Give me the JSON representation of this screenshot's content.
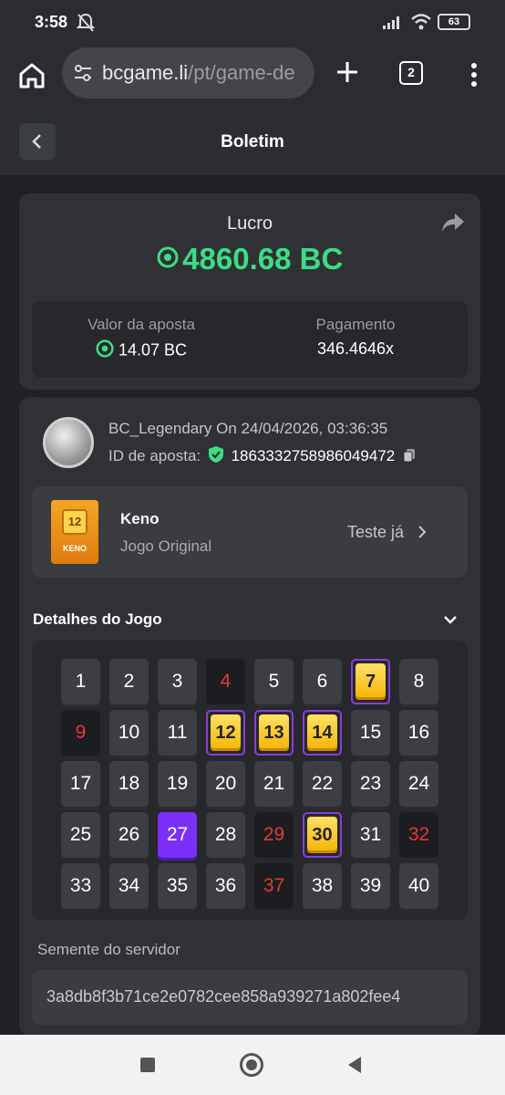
{
  "status": {
    "time": "3:58",
    "battery": "63"
  },
  "browser": {
    "url_host": "bcgame.li",
    "url_path": "/pt/game-de",
    "tab_count": "2"
  },
  "header": {
    "title": "Boletim"
  },
  "profit": {
    "label": "Lucro",
    "value": "4860.68 BC",
    "bet_label": "Valor da aposta",
    "bet_value": "14.07 BC",
    "payout_label": "Pagamento",
    "payout_value": "346.4646x"
  },
  "bet": {
    "user_line": "BC_Legendary On 24/04/2026, 03:36:35",
    "id_label": "ID de aposta:",
    "id_value": "1863332758986049472"
  },
  "game": {
    "name": "Keno",
    "subtitle": "Jogo Original",
    "try_label": "Teste já",
    "thumb_number": "12",
    "thumb_label": "KENO"
  },
  "details": {
    "title": "Detalhes do Jogo",
    "cells": [
      {
        "n": "1",
        "s": "normal"
      },
      {
        "n": "2",
        "s": "normal"
      },
      {
        "n": "3",
        "s": "normal"
      },
      {
        "n": "4",
        "s": "miss"
      },
      {
        "n": "5",
        "s": "normal"
      },
      {
        "n": "6",
        "s": "normal"
      },
      {
        "n": "7",
        "s": "hit"
      },
      {
        "n": "8",
        "s": "normal"
      },
      {
        "n": "9",
        "s": "miss"
      },
      {
        "n": "10",
        "s": "normal"
      },
      {
        "n": "11",
        "s": "normal"
      },
      {
        "n": "12",
        "s": "hit"
      },
      {
        "n": "13",
        "s": "hit"
      },
      {
        "n": "14",
        "s": "hit"
      },
      {
        "n": "15",
        "s": "normal"
      },
      {
        "n": "16",
        "s": "normal"
      },
      {
        "n": "17",
        "s": "normal"
      },
      {
        "n": "18",
        "s": "normal"
      },
      {
        "n": "19",
        "s": "normal"
      },
      {
        "n": "20",
        "s": "normal"
      },
      {
        "n": "21",
        "s": "normal"
      },
      {
        "n": "22",
        "s": "normal"
      },
      {
        "n": "23",
        "s": "normal"
      },
      {
        "n": "24",
        "s": "normal"
      },
      {
        "n": "25",
        "s": "normal"
      },
      {
        "n": "26",
        "s": "normal"
      },
      {
        "n": "27",
        "s": "pick"
      },
      {
        "n": "28",
        "s": "normal"
      },
      {
        "n": "29",
        "s": "miss"
      },
      {
        "n": "30",
        "s": "hit"
      },
      {
        "n": "31",
        "s": "normal"
      },
      {
        "n": "32",
        "s": "miss"
      },
      {
        "n": "33",
        "s": "normal"
      },
      {
        "n": "34",
        "s": "normal"
      },
      {
        "n": "35",
        "s": "normal"
      },
      {
        "n": "36",
        "s": "normal"
      },
      {
        "n": "37",
        "s": "miss"
      },
      {
        "n": "38",
        "s": "normal"
      },
      {
        "n": "39",
        "s": "normal"
      },
      {
        "n": "40",
        "s": "normal"
      }
    ]
  },
  "seed": {
    "label": "Semente do servidor",
    "value": "3a8db8f3b71ce2e0782cee858a939271a802fee4"
  },
  "colors": {
    "accent_green": "#3ddc84",
    "hit_border": "#8b3ddb",
    "pick_purple": "#7b2ff7",
    "miss_red": "#e53935"
  }
}
